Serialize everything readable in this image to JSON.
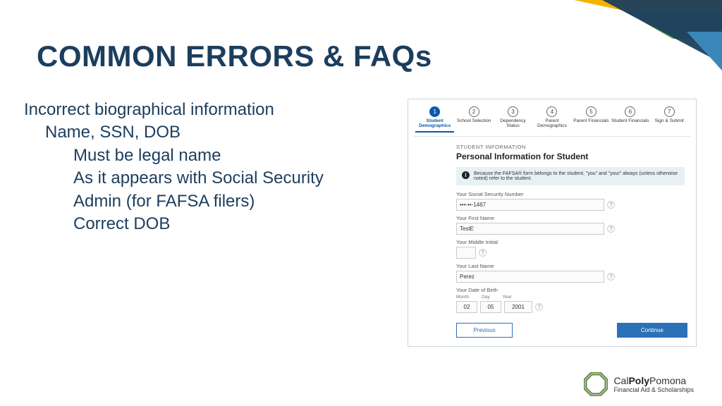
{
  "title": "COMMON ERRORS & FAQs",
  "bullets": {
    "l1": "Incorrect biographical information",
    "l2": "Name, SSN, DOB",
    "l3a": "Must be legal name",
    "l3b": "As it appears with Social Security",
    "l3c": "Admin (for FAFSA filers)",
    "l3d": "Correct DOB"
  },
  "steps": [
    {
      "num": "1",
      "label": "Student Demographics",
      "active": true
    },
    {
      "num": "2",
      "label": "School Selection",
      "active": false
    },
    {
      "num": "3",
      "label": "Dependency Status",
      "active": false
    },
    {
      "num": "4",
      "label": "Parent Demographics",
      "active": false
    },
    {
      "num": "5",
      "label": "Parent Financials",
      "active": false
    },
    {
      "num": "6",
      "label": "Student Financials",
      "active": false
    },
    {
      "num": "7",
      "label": "Sign & Submit",
      "active": false
    }
  ],
  "form": {
    "eyebrow": "STUDENT INFORMATION",
    "heading": "Personal Information for Student",
    "notice": "Because the FAFSA® form belongs to the student, \"you\" and \"your\" always (unless otherwise noted) refer to the student.",
    "ssn_label": "Your Social Security Number",
    "ssn_value": "•••-••-1467",
    "first_label": "Your First Name",
    "first_value": "TestE",
    "mi_label": "Your Middle Initial",
    "mi_value": "",
    "last_label": "Your Last Name",
    "last_value": "Perez",
    "dob_label": "Your Date of Birth",
    "dob_month_lbl": "Month",
    "dob_day_lbl": "Day",
    "dob_year_lbl": "Year",
    "dob_month": "02",
    "dob_day": "05",
    "dob_year": "2001",
    "prev": "Previous",
    "cont": "Continue"
  },
  "logo": {
    "line1a": "Cal",
    "line1b": "Poly",
    "line1c": "Pomona",
    "line2": "Financial Aid & Scholarships"
  }
}
